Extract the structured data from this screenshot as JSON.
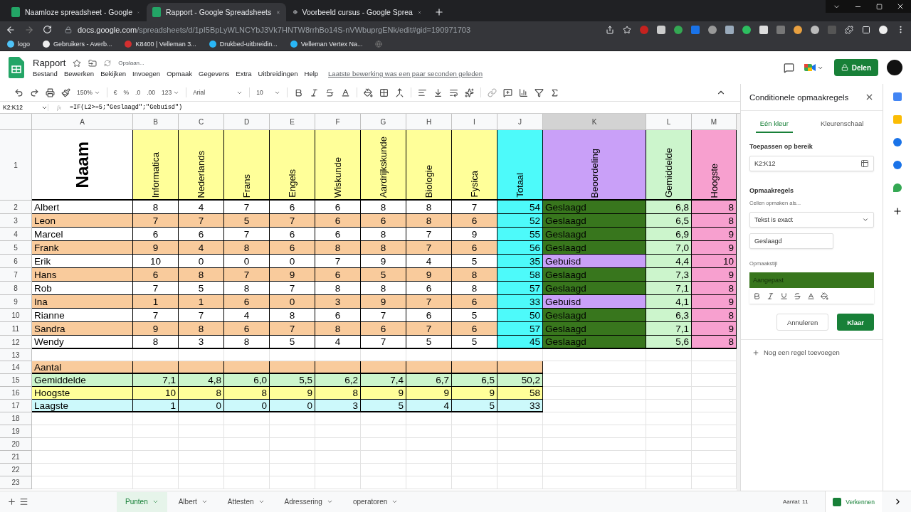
{
  "browser": {
    "tabs": [
      {
        "title": "Naamloze spreadsheet - Google",
        "selected": false
      },
      {
        "title": "Rapport - Google Spreadsheets",
        "selected": true
      },
      {
        "title": "Voorbeeld cursus - Google Sprea",
        "selected": false
      }
    ],
    "url_host": "docs.google.com",
    "url_path": "/spreadsheets/d/1pI5BpLyWLNCYbJ3Vk7HNTW8rrhBo14S-nVWbuprgENk/edit#gid=190971703",
    "bookmarks": [
      "logo",
      "Gebruikers - Averb...",
      "K8400 | Velleman 3...",
      "Drukbed-uitbreidin...",
      "Velleman Vertex Na..."
    ]
  },
  "doc": {
    "title": "Rapport",
    "save_status": "Opslaan...",
    "menu": [
      "Bestand",
      "Bewerken",
      "Bekijken",
      "Invoegen",
      "Opmaak",
      "Gegevens",
      "Extra",
      "Uitbreidingen",
      "Help"
    ],
    "last_edit": "Laatste bewerking was een paar seconden geleden",
    "share_label": "Delen"
  },
  "toolbar": {
    "zoom": "150%",
    "currency": "€",
    "percent": "%",
    "decimal_less": ".0",
    "decimal_more": ".00",
    "number_format": "123",
    "font": "Arial",
    "font_size": "10"
  },
  "formula_bar": {
    "cell_ref": "K2:K12",
    "fx_label": "fx",
    "formula": "=IF(L2>=5;\"Geslaagd\";\"Gebuisd\")"
  },
  "sheet": {
    "columns": [
      {
        "letter": "A",
        "selected": false
      },
      {
        "letter": "B",
        "selected": false
      },
      {
        "letter": "C",
        "selected": false
      },
      {
        "letter": "D",
        "selected": false
      },
      {
        "letter": "E",
        "selected": false
      },
      {
        "letter": "F",
        "selected": false
      },
      {
        "letter": "G",
        "selected": false
      },
      {
        "letter": "H",
        "selected": false
      },
      {
        "letter": "I",
        "selected": false
      },
      {
        "letter": "J",
        "selected": false
      },
      {
        "letter": "K",
        "selected": true
      },
      {
        "letter": "L",
        "selected": false
      },
      {
        "letter": "M",
        "selected": false
      }
    ],
    "headers": [
      {
        "text": "Naam",
        "color": "#ffffff"
      },
      {
        "text": "Informatica",
        "color": "#ffff99"
      },
      {
        "text": "Nederlands",
        "color": "#ffff99"
      },
      {
        "text": "Frans",
        "color": "#ffff99"
      },
      {
        "text": "Engels",
        "color": "#ffff99"
      },
      {
        "text": "Wiskunde",
        "color": "#ffff99"
      },
      {
        "text": "Aardrijkskunde",
        "color": "#ffff99"
      },
      {
        "text": "Biologie",
        "color": "#ffff99"
      },
      {
        "text": "Fysica",
        "color": "#ffff99"
      },
      {
        "text": "Totaal",
        "color": "#4dfafa"
      },
      {
        "text": "Beoordeling",
        "color": "#c9a0f8"
      },
      {
        "text": "Gemiddelde",
        "color": "#ccf5cc"
      },
      {
        "text": "Hoogste",
        "color": "#f7a0cf"
      }
    ],
    "students": [
      {
        "name": "Albert",
        "color": "#ffffff",
        "grades": [
          "8",
          "4",
          "7",
          "6",
          "6",
          "8",
          "8",
          "7"
        ],
        "total": "54",
        "result": {
          "text": "Geslaagd",
          "color": "#38761d"
        },
        "average": "6,8",
        "max": "8"
      },
      {
        "name": "Leon",
        "color": "#f9cb9c",
        "grades": [
          "7",
          "7",
          "5",
          "7",
          "6",
          "6",
          "8",
          "6"
        ],
        "total": "52",
        "result": {
          "text": "Geslaagd",
          "color": "#38761d"
        },
        "average": "6,5",
        "max": "8"
      },
      {
        "name": "Marcel",
        "color": "#ffffff",
        "grades": [
          "6",
          "6",
          "7",
          "6",
          "6",
          "8",
          "7",
          "9"
        ],
        "total": "55",
        "result": {
          "text": "Geslaagd",
          "color": "#38761d"
        },
        "average": "6,9",
        "max": "9"
      },
      {
        "name": "Frank",
        "color": "#f9cb9c",
        "grades": [
          "9",
          "4",
          "8",
          "6",
          "8",
          "8",
          "7",
          "6"
        ],
        "total": "56",
        "result": {
          "text": "Geslaagd",
          "color": "#38761d"
        },
        "average": "7,0",
        "max": "9"
      },
      {
        "name": "Erik",
        "color": "#ffffff",
        "grades": [
          "10",
          "0",
          "0",
          "0",
          "7",
          "9",
          "4",
          "5"
        ],
        "total": "35",
        "result": {
          "text": "Gebuisd",
          "color": "#c9a0f8"
        },
        "average": "4,4",
        "max": "10"
      },
      {
        "name": "Hans",
        "color": "#f9cb9c",
        "grades": [
          "6",
          "8",
          "7",
          "9",
          "6",
          "5",
          "9",
          "8"
        ],
        "total": "58",
        "result": {
          "text": "Geslaagd",
          "color": "#38761d"
        },
        "average": "7,3",
        "max": "9"
      },
      {
        "name": "Rob",
        "color": "#ffffff",
        "grades": [
          "7",
          "5",
          "8",
          "7",
          "8",
          "8",
          "6",
          "8"
        ],
        "total": "57",
        "result": {
          "text": "Geslaagd",
          "color": "#38761d"
        },
        "average": "7,1",
        "max": "8"
      },
      {
        "name": "Ina",
        "color": "#f9cb9c",
        "grades": [
          "1",
          "1",
          "6",
          "0",
          "3",
          "9",
          "7",
          "6"
        ],
        "total": "33",
        "result": {
          "text": "Gebuisd",
          "color": "#c9a0f8"
        },
        "average": "4,1",
        "max": "9"
      },
      {
        "name": "Rianne",
        "color": "#ffffff",
        "grades": [
          "7",
          "7",
          "4",
          "8",
          "6",
          "7",
          "6",
          "5"
        ],
        "total": "50",
        "result": {
          "text": "Geslaagd",
          "color": "#38761d"
        },
        "average": "6,3",
        "max": "8"
      },
      {
        "name": "Sandra",
        "color": "#f9cb9c",
        "grades": [
          "9",
          "8",
          "6",
          "7",
          "8",
          "6",
          "7",
          "6"
        ],
        "total": "57",
        "result": {
          "text": "Geslaagd",
          "color": "#38761d"
        },
        "average": "7,1",
        "max": "9"
      },
      {
        "name": "Wendy",
        "color": "#ffffff",
        "grades": [
          "8",
          "3",
          "8",
          "5",
          "4",
          "7",
          "5",
          "5"
        ],
        "total": "45",
        "result": {
          "text": "Geslaagd",
          "color": "#38761d"
        },
        "average": "5,6",
        "max": "8"
      }
    ],
    "summary": [
      {
        "label": "Aantal",
        "color": "#f9cb9c"
      },
      {
        "label": "Gemiddelde",
        "color": "#ccf5cc",
        "values": [
          "7,1",
          "4,8",
          "6,0",
          "5,5",
          "6,2",
          "7,4",
          "6,7",
          "6,5",
          "50,2"
        ]
      },
      {
        "label": "Hoogste",
        "color": "#ffff99",
        "values": [
          "10",
          "8",
          "8",
          "9",
          "8",
          "9",
          "9",
          "9",
          "58"
        ]
      },
      {
        "label": "Laagste",
        "color": "#ccf9fb",
        "values": [
          "1",
          "0",
          "0",
          "0",
          "3",
          "5",
          "4",
          "5",
          "33"
        ]
      }
    ],
    "row_numbers": [
      "1",
      "2",
      "3",
      "4",
      "5",
      "6",
      "7",
      "8",
      "9",
      "10",
      "11",
      "12",
      "13",
      "14",
      "15",
      "16",
      "17",
      "18",
      "19",
      "20",
      "21",
      "22",
      "23"
    ]
  },
  "panel": {
    "title": "Conditionele opmaakregels",
    "tabs": [
      {
        "label": "Eén kleur",
        "selected": true
      },
      {
        "label": "Kleurenschaal",
        "selected": false
      }
    ],
    "range_label": "Toepassen op bereik",
    "range": "K2:K12",
    "rules_label": "Opmaakregels",
    "condition_label": "Cellen opmaken als...",
    "condition": "Tekst is exact",
    "value": "Geslaagd",
    "style_label": "Opmaakstijl",
    "style_preview": "Aangepast",
    "cancel": "Annuleren",
    "done": "Klaar",
    "add_rule": "Nog een regel toevoegen"
  },
  "sheet_tabs": [
    {
      "label": "Punten",
      "selected": true
    },
    {
      "label": "Albert",
      "selected": false
    },
    {
      "label": "Attesten",
      "selected": false
    },
    {
      "label": "Adressering",
      "selected": false
    },
    {
      "label": "operatoren",
      "selected": false
    }
  ],
  "status": {
    "count": "Aantal: 11",
    "explore": "Verkennen"
  }
}
